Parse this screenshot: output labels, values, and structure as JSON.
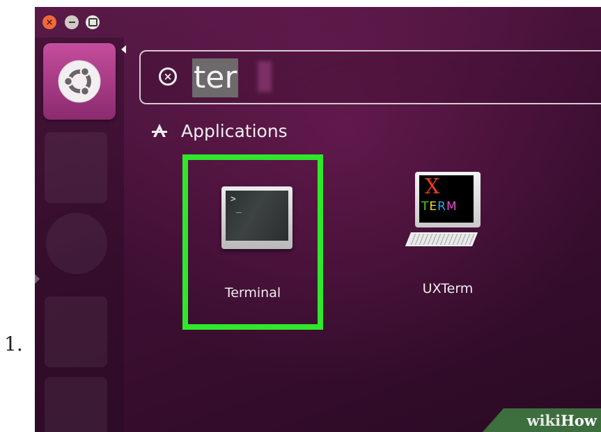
{
  "step": {
    "number": "1."
  },
  "window_controls": {
    "close_glyph": "×",
    "icons": [
      "close-icon",
      "minimize-icon",
      "maximize-icon"
    ]
  },
  "launcher": {
    "dash_icon": "ubuntu-logo-icon"
  },
  "search": {
    "query": "ter",
    "clear_icon_glyph": "×"
  },
  "results": {
    "section_title": "Applications",
    "apps": [
      {
        "name": "Terminal",
        "icon": "terminal-icon",
        "highlighted": true
      },
      {
        "name": "UXTerm",
        "icon": "uxterm-icon",
        "highlighted": false
      }
    ],
    "uxterm_icon_text": {
      "x": "X",
      "term": "TERM"
    }
  },
  "colors": {
    "highlight": "#2ee82b",
    "background": "#4a1540",
    "xterm_x": "#e83a1e"
  },
  "watermark": {
    "text_wiki": "wiki",
    "text_how": "How"
  }
}
